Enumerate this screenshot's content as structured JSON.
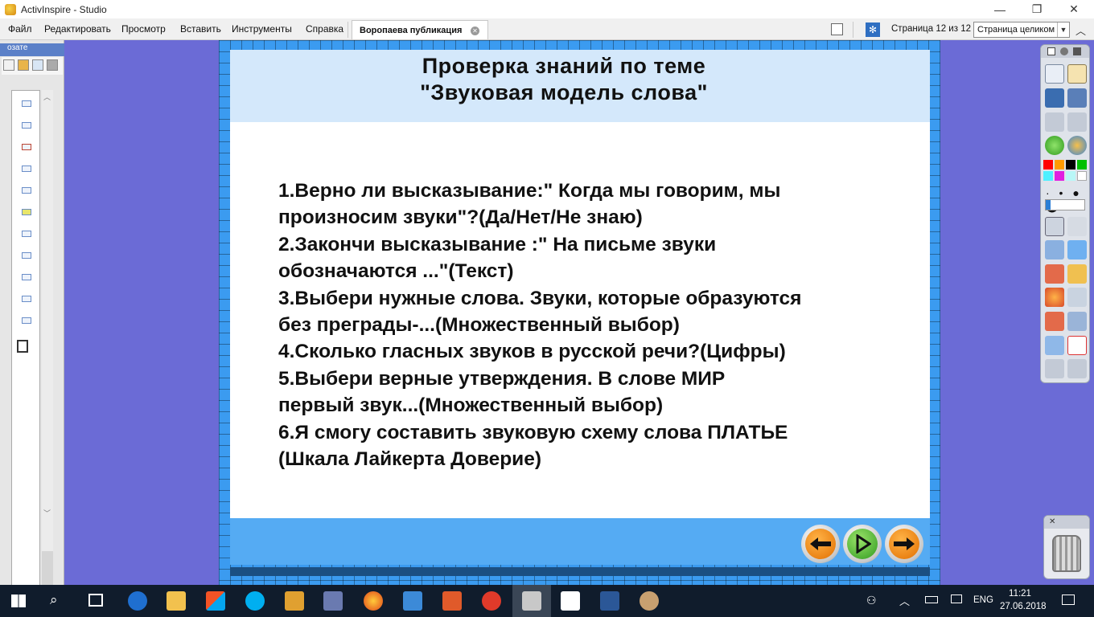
{
  "window": {
    "title": "ActivInspire - Studio",
    "controls": [
      "—",
      "❐",
      "✕"
    ]
  },
  "menu": {
    "items": [
      "Файл",
      "Редактировать",
      "Просмотр",
      "Вставить",
      "Инструменты",
      "Справка"
    ],
    "document_tab": "Воропаева публикация",
    "page_counter": "Страница 12 из 12",
    "zoom_value": "Страница целиком"
  },
  "browser_panel": {
    "header": "озате"
  },
  "slide": {
    "title_line1": "Проверка знаний по теме",
    "title_line2": "\"Звуковая модель слова\"",
    "questions": [
      "1.Верно ли высказывание:\" Когда мы говорим, мы",
      "произносим звуки\"?(Да/Нет/Не знаю)",
      "2.Закончи высказывание :\" На письме звуки",
      "обозначаются ...\"(Текст)",
      "3.Выбери нужные слова. Звуки, которые образуются",
      "без преграды-...(Множественный выбор)",
      "4.Сколько гласных звуков в русской речи?(Цифры)",
      "5.Выбери верные утверждения. В слове МИР",
      "первый звук...(Множественный выбор)",
      "6.Я смогу составить звуковую схему слова ПЛАТЬЕ",
      "(Шкала Лайкерта Доверие)"
    ],
    "nav_buttons": {
      "prev_icon": "arrow-left-icon",
      "play_icon": "play-icon",
      "next_icon": "arrow-right-icon"
    }
  },
  "colors": {
    "slide_background": "#3b9bf0",
    "title_band": "#d4e8fb",
    "accent_orange": "#f08a00",
    "accent_green": "#3aa82a",
    "taskbar": "#101c2c"
  },
  "taskbar": {
    "language": "ENG",
    "time": "11:21",
    "date": "27.06.2018"
  }
}
